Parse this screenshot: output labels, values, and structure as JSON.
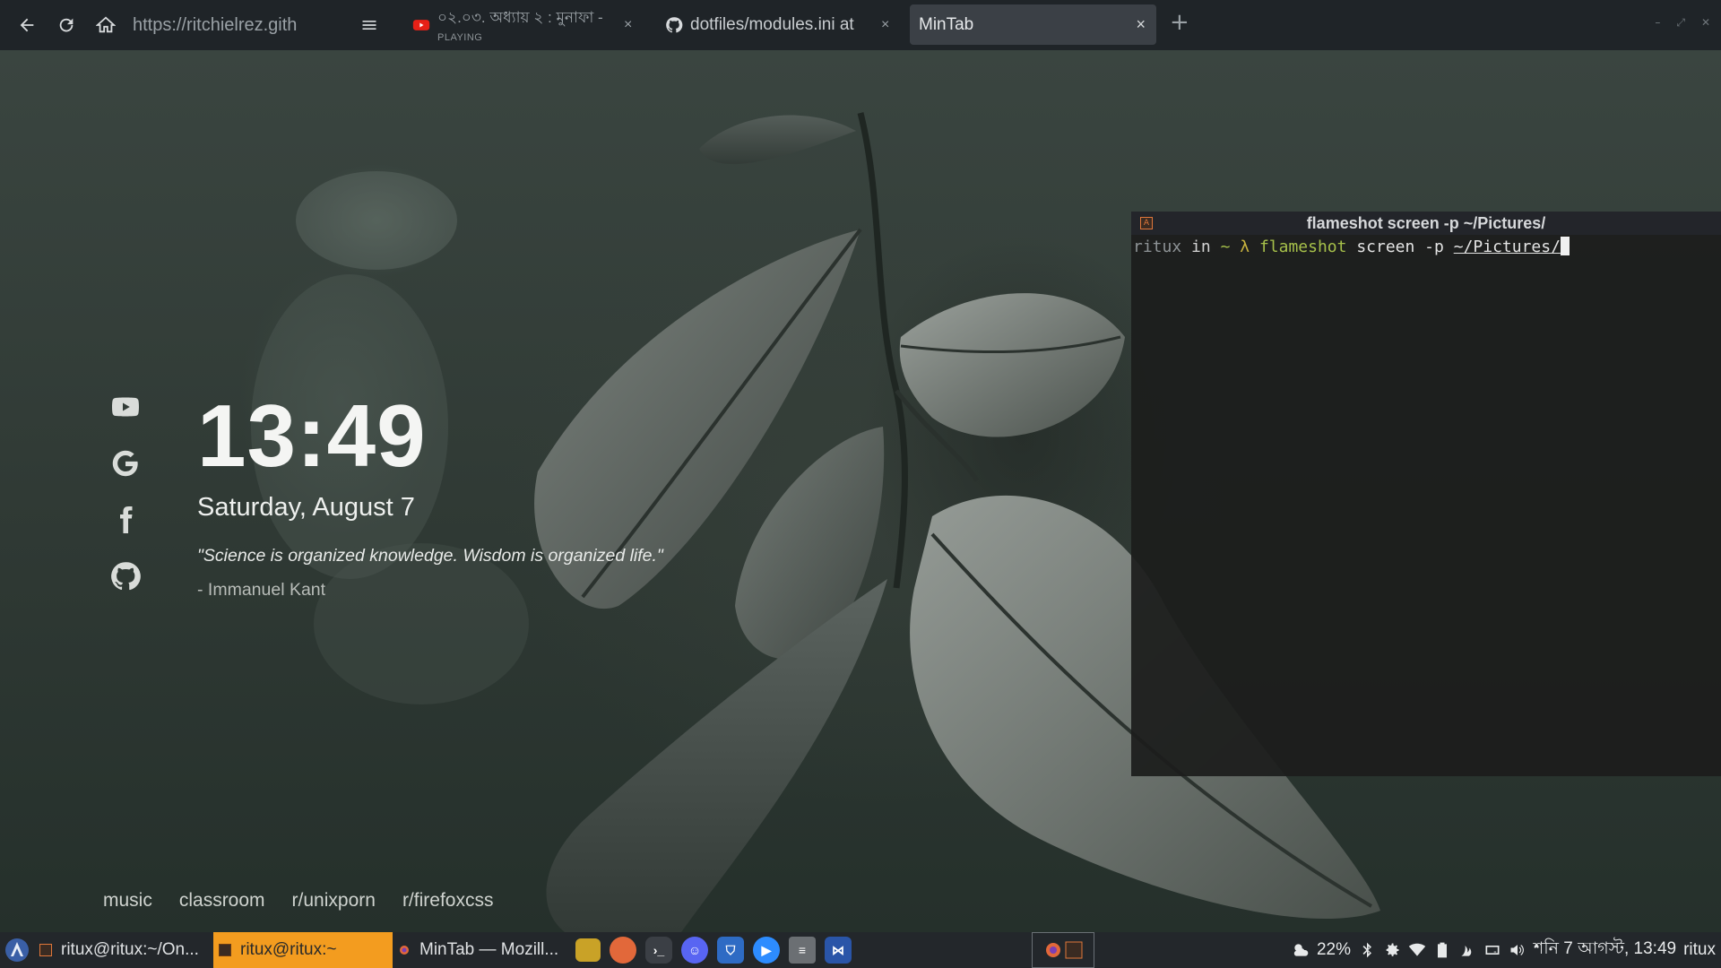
{
  "browser": {
    "url": "https://ritchielrez.gith",
    "tabs": [
      {
        "title": "০২.০৩. অধ্যায় ২ : মুনাফা -",
        "subtitle": "PLAYING",
        "icon": "youtube-icon"
      },
      {
        "title": "dotfiles/modules.ini at",
        "icon": "github-icon"
      },
      {
        "title": "MinTab",
        "icon": "none",
        "active": true
      }
    ],
    "new_tab_label": "+",
    "close_glyph": "×"
  },
  "startpage": {
    "time": "13:49",
    "date": "Saturday, August 7",
    "quote": "\"Science is organized knowledge. Wisdom is organized life.\"",
    "author": "- Immanuel Kant",
    "social_icons": [
      "youtube-icon",
      "google-icon",
      "facebook-icon",
      "github-icon"
    ],
    "links": [
      "music",
      "classroom",
      "r/unixporn",
      "r/firefoxcss"
    ]
  },
  "terminal": {
    "title": "flameshot screen -p ~/Pictures/",
    "prompt_user": "ritux",
    "prompt_in": "in",
    "prompt_dir": "~",
    "prompt_symbol": "λ",
    "command": "flameshot",
    "args": "screen -p",
    "path_arg": "~/Pictures/"
  },
  "taskbar": {
    "tasks": [
      {
        "label": "ritux@ritux:~/On...",
        "active": false
      },
      {
        "label": "ritux@ritux:~",
        "active": true
      },
      {
        "label": "MinTab — Mozill...",
        "active": false
      }
    ],
    "launchers": [
      "files-icon",
      "firefox-icon",
      "terminal-icon",
      "discord-icon",
      "bitwarden-icon",
      "zoom-icon",
      "stack-icon",
      "vscode-icon"
    ],
    "tray": {
      "battery": "22%",
      "datetime": "শনি  7 আগস্ট, 13:49",
      "user": "ritux"
    }
  },
  "colors": {
    "accent_task": "#f39c1f",
    "terminal_prompt_green": "#a6c04a",
    "terminal_lambda": "#c9b33e"
  }
}
